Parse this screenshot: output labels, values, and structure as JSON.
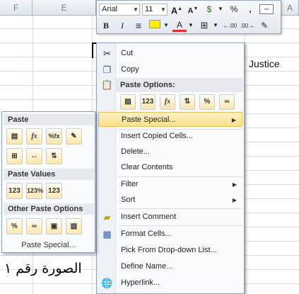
{
  "sheet": {
    "columns": [
      "F",
      "E",
      "A"
    ],
    "cell_text": "Justice"
  },
  "mini_toolbar": {
    "font_name": "Arial",
    "font_size": "11",
    "grow_font": "A",
    "shrink_font": "A",
    "currency": "$",
    "percent": "%",
    "comma": ",",
    "bold": "B",
    "italic": "I",
    "font_color": "A",
    "decrease_decimal": ".00",
    "increase_decimal": ".00"
  },
  "context_menu": {
    "items": [
      {
        "label": "Cut",
        "icon": "scissors-icon"
      },
      {
        "label": "Copy",
        "icon": "copy-icon"
      },
      {
        "label": "Paste Options:",
        "icon": "paste-icon"
      },
      {
        "label": "Paste Special...",
        "icon": ""
      },
      {
        "label": "Insert Copied Cells...",
        "icon": ""
      },
      {
        "label": "Delete...",
        "icon": ""
      },
      {
        "label": "Clear Contents",
        "icon": ""
      },
      {
        "label": "Filter",
        "icon": ""
      },
      {
        "label": "Sort",
        "icon": ""
      },
      {
        "label": "Insert Comment",
        "icon": "comment-icon"
      },
      {
        "label": "Format Cells...",
        "icon": "format-cells-icon"
      },
      {
        "label": "Pick From Drop-down List...",
        "icon": ""
      },
      {
        "label": "Define Name...",
        "icon": ""
      },
      {
        "label": "Hyperlink...",
        "icon": "hyperlink-icon"
      }
    ],
    "paste_buttons": [
      "paste",
      "123",
      "fx",
      "transpose",
      "%",
      "link"
    ]
  },
  "paste_special_menu": {
    "paste_header": "Paste",
    "paste_values_header": "Paste Values",
    "other_header": "Other Paste Options",
    "footer": "Paste Special...",
    "paste_row1": [
      "paste",
      "fx",
      "%fx",
      "formatting"
    ],
    "paste_row2": [
      "no-borders",
      "column-widths",
      "transpose"
    ],
    "values_row": [
      "123",
      "123%",
      "123"
    ],
    "other_row": [
      "%",
      "link",
      "picture",
      "linked-picture"
    ]
  },
  "caption": "الصورة رقم ١",
  "colors": {
    "accent": "#fbe08c",
    "menu_border": "#8fa2b8",
    "grid": "#d4dce6"
  }
}
